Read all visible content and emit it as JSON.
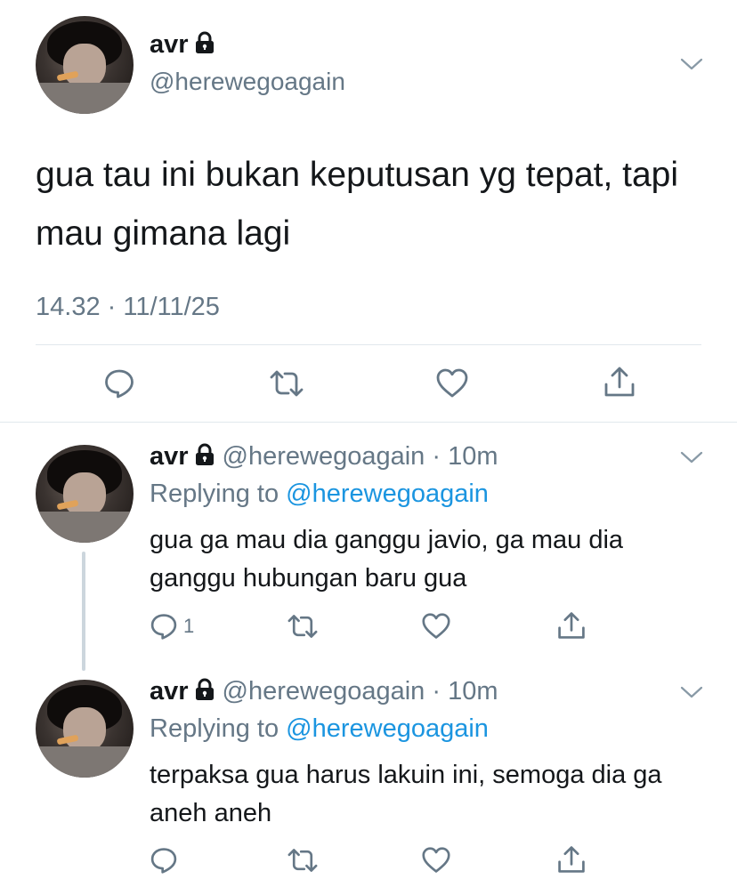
{
  "main_tweet": {
    "name": "avr",
    "handle": "@herewegoagain",
    "text": "gua tau ini bukan keputusan yg tepat, tapi mau gimana lagi",
    "timestamp": "14.32 · 11/11/25"
  },
  "replies": [
    {
      "name": "avr",
      "handle": "@herewegoagain",
      "time": "10m",
      "replying_prefix": "Replying to ",
      "replying_to": "@herewegoagain",
      "text": "gua ga mau dia ganggu javio, ga mau dia ganggu hubungan baru gua",
      "reply_count": "1"
    },
    {
      "name": "avr",
      "handle": "@herewegoagain",
      "time": "10m",
      "replying_prefix": "Replying to ",
      "replying_to": "@herewegoagain",
      "text": "terpaksa gua harus lakuin ini, semoga dia ga aneh aneh",
      "reply_count": ""
    }
  ],
  "colors": {
    "text": "#14171a",
    "secondary": "#657786",
    "link": "#1b95e0",
    "divider": "#e1e8ed",
    "thread_line": "#ccd6dd"
  },
  "icons": [
    "lock-icon",
    "chevron-down-icon",
    "reply-icon",
    "retweet-icon",
    "like-icon",
    "share-icon"
  ]
}
